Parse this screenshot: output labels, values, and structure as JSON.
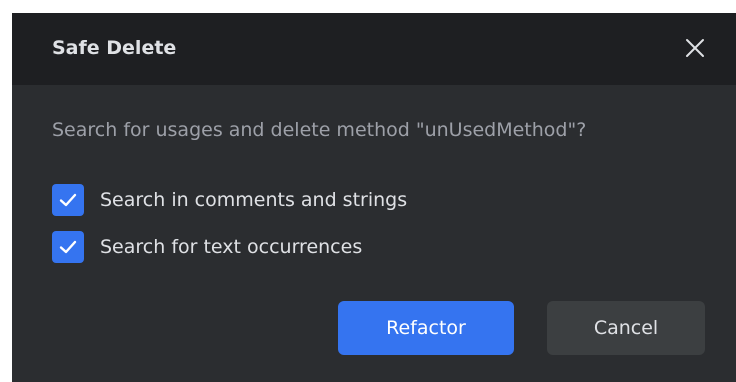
{
  "dialog": {
    "title": "Safe Delete",
    "close_icon": "close-icon",
    "prompt": "Search for usages and delete method \"unUsedMethod\"?",
    "options": [
      {
        "label": "Search in comments and strings",
        "checked": true
      },
      {
        "label": "Search for text occurrences",
        "checked": true
      }
    ],
    "buttons": {
      "refactor_label": "Refactor",
      "cancel_label": "Cancel"
    }
  },
  "colors": {
    "dialog_background": "#2b2d30",
    "title_bar_background": "#1e1f22",
    "accent": "#3574f0",
    "text_primary": "#dfe1e5",
    "text_secondary": "#9da0a8",
    "secondary_button": "#3c3f41"
  }
}
